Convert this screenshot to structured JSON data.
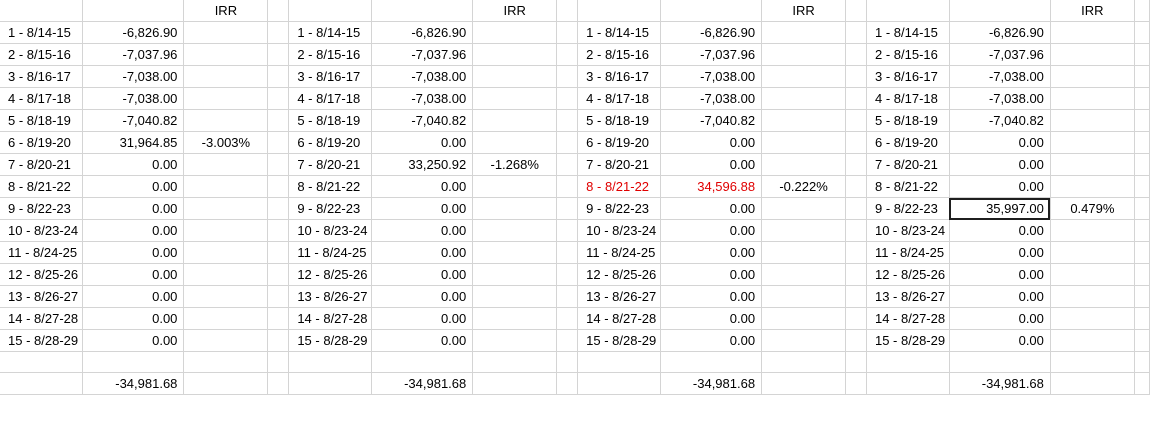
{
  "header": {
    "irr_label": "IRR"
  },
  "blocks": [
    {
      "rows": [
        {
          "period": "1 - 8/14-15",
          "value": "-6,826.90",
          "irr": ""
        },
        {
          "period": "2 - 8/15-16",
          "value": "-7,037.96",
          "irr": ""
        },
        {
          "period": "3 - 8/16-17",
          "value": "-7,038.00",
          "irr": ""
        },
        {
          "period": "4 - 8/17-18",
          "value": "-7,038.00",
          "irr": ""
        },
        {
          "period": "5 - 8/18-19",
          "value": "-7,040.82",
          "irr": ""
        },
        {
          "period": "6 - 8/19-20",
          "value": "31,964.85",
          "irr": "-3.003%"
        },
        {
          "period": "7 - 8/20-21",
          "value": "0.00",
          "irr": ""
        },
        {
          "period": "8 - 8/21-22",
          "value": "0.00",
          "irr": ""
        },
        {
          "period": "9 - 8/22-23",
          "value": "0.00",
          "irr": ""
        },
        {
          "period": "10 - 8/23-24",
          "value": "0.00",
          "irr": ""
        },
        {
          "period": "11 - 8/24-25",
          "value": "0.00",
          "irr": ""
        },
        {
          "period": "12 - 8/25-26",
          "value": "0.00",
          "irr": ""
        },
        {
          "period": "13 - 8/26-27",
          "value": "0.00",
          "irr": ""
        },
        {
          "period": "14 - 8/27-28",
          "value": "0.00",
          "irr": ""
        },
        {
          "period": "15 - 8/28-29",
          "value": "0.00",
          "irr": ""
        }
      ],
      "total": "-34,981.68"
    },
    {
      "rows": [
        {
          "period": "1 - 8/14-15",
          "value": "-6,826.90",
          "irr": ""
        },
        {
          "period": "2 - 8/15-16",
          "value": "-7,037.96",
          "irr": ""
        },
        {
          "period": "3 - 8/16-17",
          "value": "-7,038.00",
          "irr": ""
        },
        {
          "period": "4 - 8/17-18",
          "value": "-7,038.00",
          "irr": ""
        },
        {
          "period": "5 - 8/18-19",
          "value": "-7,040.82",
          "irr": ""
        },
        {
          "period": "6 - 8/19-20",
          "value": "0.00",
          "irr": ""
        },
        {
          "period": "7 - 8/20-21",
          "value": "33,250.92",
          "irr": "-1.268%"
        },
        {
          "period": "8 - 8/21-22",
          "value": "0.00",
          "irr": ""
        },
        {
          "period": "9 - 8/22-23",
          "value": "0.00",
          "irr": ""
        },
        {
          "period": "10 - 8/23-24",
          "value": "0.00",
          "irr": ""
        },
        {
          "period": "11 - 8/24-25",
          "value": "0.00",
          "irr": ""
        },
        {
          "period": "12 - 8/25-26",
          "value": "0.00",
          "irr": ""
        },
        {
          "period": "13 - 8/26-27",
          "value": "0.00",
          "irr": ""
        },
        {
          "period": "14 - 8/27-28",
          "value": "0.00",
          "irr": ""
        },
        {
          "period": "15 - 8/28-29",
          "value": "0.00",
          "irr": ""
        }
      ],
      "total": "-34,981.68"
    },
    {
      "rows": [
        {
          "period": "1 - 8/14-15",
          "value": "-6,826.90",
          "irr": ""
        },
        {
          "period": "2 - 8/15-16",
          "value": "-7,037.96",
          "irr": ""
        },
        {
          "period": "3 - 8/16-17",
          "value": "-7,038.00",
          "irr": ""
        },
        {
          "period": "4 - 8/17-18",
          "value": "-7,038.00",
          "irr": ""
        },
        {
          "period": "5 - 8/18-19",
          "value": "-7,040.82",
          "irr": ""
        },
        {
          "period": "6 - 8/19-20",
          "value": "0.00",
          "irr": ""
        },
        {
          "period": "7 - 8/20-21",
          "value": "0.00",
          "irr": ""
        },
        {
          "period": "8 - 8/21-22",
          "value": "34,596.88",
          "irr": "-0.222%",
          "highlight": true
        },
        {
          "period": "9 - 8/22-23",
          "value": "0.00",
          "irr": ""
        },
        {
          "period": "10 - 8/23-24",
          "value": "0.00",
          "irr": ""
        },
        {
          "period": "11 - 8/24-25",
          "value": "0.00",
          "irr": ""
        },
        {
          "period": "12 - 8/25-26",
          "value": "0.00",
          "irr": ""
        },
        {
          "period": "13 - 8/26-27",
          "value": "0.00",
          "irr": ""
        },
        {
          "period": "14 - 8/27-28",
          "value": "0.00",
          "irr": ""
        },
        {
          "period": "15 - 8/28-29",
          "value": "0.00",
          "irr": ""
        }
      ],
      "total": "-34,981.68"
    },
    {
      "rows": [
        {
          "period": "1 - 8/14-15",
          "value": "-6,826.90",
          "irr": ""
        },
        {
          "period": "2 - 8/15-16",
          "value": "-7,037.96",
          "irr": ""
        },
        {
          "period": "3 - 8/16-17",
          "value": "-7,038.00",
          "irr": ""
        },
        {
          "period": "4 - 8/17-18",
          "value": "-7,038.00",
          "irr": ""
        },
        {
          "period": "5 - 8/18-19",
          "value": "-7,040.82",
          "irr": ""
        },
        {
          "period": "6 - 8/19-20",
          "value": "0.00",
          "irr": ""
        },
        {
          "period": "7 - 8/20-21",
          "value": "0.00",
          "irr": ""
        },
        {
          "period": "8 - 8/21-22",
          "value": "0.00",
          "irr": ""
        },
        {
          "period": "9 - 8/22-23",
          "value": "35,997.00",
          "irr": "0.479%",
          "selected": true
        },
        {
          "period": "10 - 8/23-24",
          "value": "0.00",
          "irr": ""
        },
        {
          "period": "11 - 8/24-25",
          "value": "0.00",
          "irr": ""
        },
        {
          "period": "12 - 8/25-26",
          "value": "0.00",
          "irr": ""
        },
        {
          "period": "13 - 8/26-27",
          "value": "0.00",
          "irr": ""
        },
        {
          "period": "14 - 8/27-28",
          "value": "0.00",
          "irr": ""
        },
        {
          "period": "15 - 8/28-29",
          "value": "0.00",
          "irr": ""
        }
      ],
      "total": "-34,981.68"
    }
  ],
  "colors": {
    "highlight_text": "#e00000",
    "gridline": "#d4d4d4"
  }
}
